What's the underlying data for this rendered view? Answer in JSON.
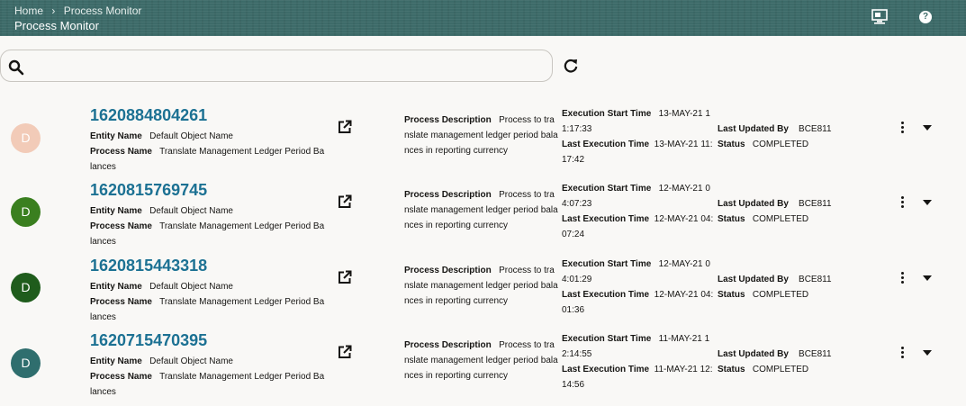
{
  "breadcrumb": {
    "home": "Home",
    "separator": "›",
    "current": "Process Monitor"
  },
  "page_title": "Process Monitor",
  "header_icons": [
    "monitor-icon",
    "help-icon"
  ],
  "help_glyph": "?",
  "search": {
    "value": "",
    "placeholder": ""
  },
  "labels": {
    "entity_name": "Entity Name",
    "process_name": "Process Name",
    "process_description": "Process Description",
    "execution_start_time": "Execution Start Time",
    "last_execution_time": "Last Execution Time",
    "last_updated_by": "Last Updated By",
    "status": "Status"
  },
  "colors": {
    "header": "#3d6b69",
    "process_id": "#1c7193"
  },
  "rows": [
    {
      "avatar": "D",
      "avatar_color": "#f2cbb8",
      "id": "1620884804261",
      "entity_name": "Default Object Name",
      "process_name": "Translate Management Ledger Period Balances",
      "process_description": "Process to translate management ledger period balances in reporting currency",
      "execution_start_time": "13-MAY-21 11:17:33",
      "last_execution_time": "13-MAY-21 11:17:42",
      "last_updated_by": "BCE811",
      "status": "COMPLETED"
    },
    {
      "avatar": "D",
      "avatar_color": "#3a7f1f",
      "id": "1620815769745",
      "entity_name": "Default Object Name",
      "process_name": "Translate Management Ledger Period Balances",
      "process_description": "Process to translate management ledger period balances in reporting currency",
      "execution_start_time": "12-MAY-21 04:07:23",
      "last_execution_time": "12-MAY-21 04:07:24",
      "last_updated_by": "BCE811",
      "status": "COMPLETED"
    },
    {
      "avatar": "D",
      "avatar_color": "#1f5c1c",
      "id": "1620815443318",
      "entity_name": "Default Object Name",
      "process_name": "Translate Management Ledger Period Balances",
      "process_description": "Process to translate management ledger period balances in reporting currency",
      "execution_start_time": "12-MAY-21 04:01:29",
      "last_execution_time": "12-MAY-21 04:01:36",
      "last_updated_by": "BCE811",
      "status": "COMPLETED"
    },
    {
      "avatar": "D",
      "avatar_color": "#2f6e6e",
      "id": "1620715470395",
      "entity_name": "Default Object Name",
      "process_name": "Translate Management Ledger Period Balances",
      "process_description": "Process to translate management ledger period balances in reporting currency",
      "execution_start_time": "11-MAY-21 12:14:55",
      "last_execution_time": "11-MAY-21 12:14:56",
      "last_updated_by": "BCE811",
      "status": "COMPLETED"
    }
  ]
}
